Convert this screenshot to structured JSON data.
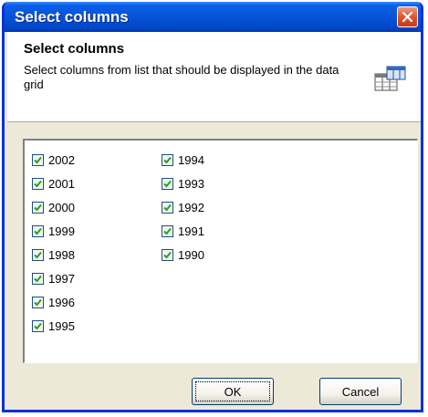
{
  "window": {
    "title": "Select columns"
  },
  "header": {
    "title": "Select columns",
    "description": "Select columns from list that should be displayed in the data grid"
  },
  "columns": [
    {
      "label": "2002",
      "checked": true
    },
    {
      "label": "2001",
      "checked": true
    },
    {
      "label": "2000",
      "checked": true
    },
    {
      "label": "1999",
      "checked": true
    },
    {
      "label": "1998",
      "checked": true
    },
    {
      "label": "1997",
      "checked": true
    },
    {
      "label": "1996",
      "checked": true
    },
    {
      "label": "1995",
      "checked": true
    },
    {
      "label": "1994",
      "checked": true
    },
    {
      "label": "1993",
      "checked": true
    },
    {
      "label": "1992",
      "checked": true
    },
    {
      "label": "1991",
      "checked": true
    },
    {
      "label": "1990",
      "checked": true
    }
  ],
  "buttons": {
    "ok_label": "OK",
    "cancel_label": "Cancel"
  },
  "colors": {
    "titlebar": "#0653d8",
    "dialog_bg": "#ece9d8",
    "close_button": "#e0552f"
  },
  "icons": {
    "close": "close-icon",
    "header": "columns-table-icon",
    "checkbox": "checkmark-icon"
  }
}
